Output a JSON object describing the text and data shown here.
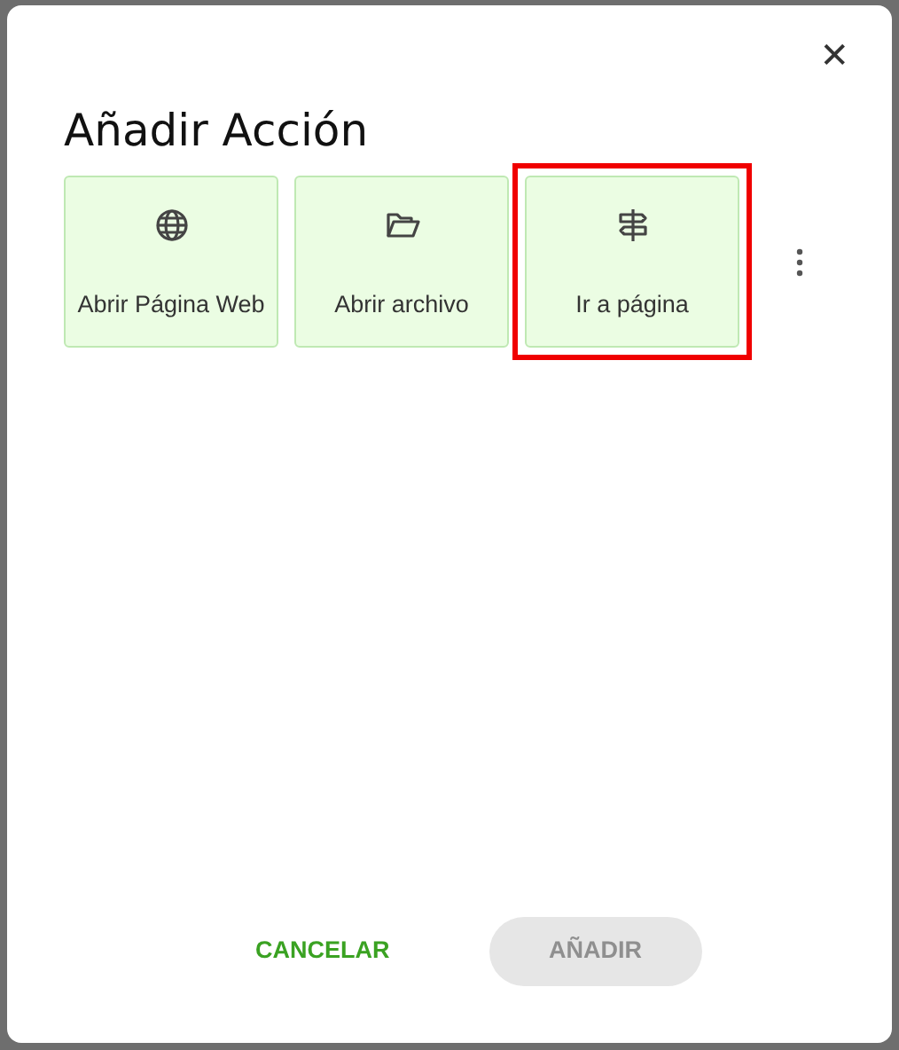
{
  "dialog": {
    "close": "✕",
    "title": "Añadir Acción"
  },
  "actions": [
    {
      "kind": "globe",
      "label": "Abrir Página Web",
      "selected": false
    },
    {
      "kind": "folder",
      "label": "Abrir archivo",
      "selected": false
    },
    {
      "kind": "signpost",
      "label": "Ir a página",
      "selected": true
    }
  ],
  "buttons": [
    {
      "label": "CANCELAR",
      "kind": "text",
      "disabled": false
    },
    {
      "label": "AÑADIR",
      "kind": "filled",
      "disabled": true
    }
  ]
}
